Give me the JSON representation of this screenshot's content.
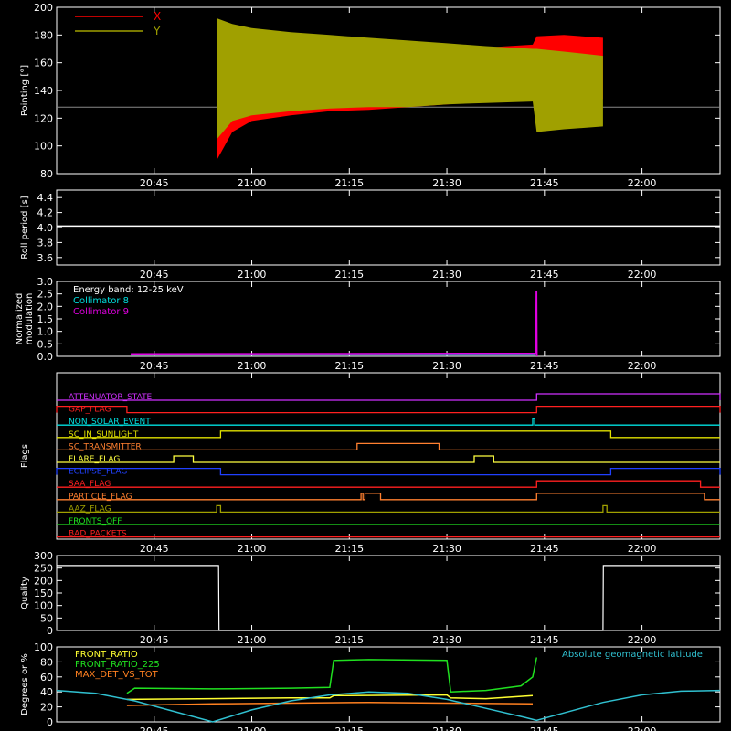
{
  "chart_data": [
    {
      "id": "pointing",
      "type": "line",
      "ylabel": "Pointing [°]",
      "ylim": [
        80,
        200
      ],
      "yticks": [
        "80",
        "100",
        "120",
        "140",
        "160",
        "180",
        "200"
      ],
      "xlim": [
        20.5,
        22.2
      ],
      "xticks": [
        "20:45",
        "21:00",
        "21:15",
        "21:30",
        "21:45",
        "22:00"
      ],
      "reference_line": 128,
      "series": [
        {
          "name": "X",
          "color": "#ff0000",
          "envelope": {
            "t": [
              20.911,
              20.95,
              21.0,
              21.1,
              21.2,
              21.3,
              21.4,
              21.5,
              21.6,
              21.72,
              21.73,
              21.8,
              21.9
            ],
            "lo": [
              90,
              110,
              118,
              122,
              125,
              126,
              128,
              130,
              132,
              134,
              130,
              132,
              134
            ],
            "hi": [
              175,
              168,
              165,
              166,
              168,
              170,
              170,
              168,
              171,
              173,
              179,
              180,
              178
            ]
          }
        },
        {
          "name": "Y",
          "color": "#a0a000",
          "envelope": {
            "t": [
              20.911,
              20.95,
              21.0,
              21.1,
              21.2,
              21.3,
              21.4,
              21.5,
              21.6,
              21.72,
              21.73,
              21.8,
              21.9
            ],
            "lo": [
              105,
              118,
              122,
              125,
              127,
              128,
              128,
              130,
              131,
              132,
              110,
              112,
              114
            ],
            "hi": [
              192,
              188,
              185,
              182,
              180,
              178,
              176,
              174,
              172,
              170,
              170,
              168,
              165
            ]
          }
        }
      ]
    },
    {
      "id": "roll",
      "type": "line",
      "ylabel": "Roll period [s]",
      "ylim": [
        3.5,
        4.5
      ],
      "yticks": [
        "3.6",
        "3.8",
        "4.0",
        "4.2",
        "4.4"
      ],
      "xlim": [
        20.5,
        22.2
      ],
      "xticks": [
        "20:45",
        "21:00",
        "21:15",
        "21:30",
        "21:45",
        "22:00"
      ],
      "series": [
        {
          "name": "",
          "color": "#ffffff",
          "x": [
            20.5,
            22.2
          ],
          "y": [
            4.02,
            4.02
          ]
        }
      ]
    },
    {
      "id": "modulation",
      "type": "line",
      "ylabel": "Normalized modulation",
      "ylim": [
        0,
        3.0
      ],
      "yticks": [
        "0.0",
        "0.5",
        "1.0",
        "1.5",
        "2.0",
        "2.5",
        "3.0"
      ],
      "xlim": [
        20.5,
        22.2
      ],
      "xticks": [
        "20:45",
        "21:00",
        "21:15",
        "21:30",
        "21:45",
        "22:00"
      ],
      "legend": [
        "Energy band: 12-25 keV",
        "Collimator 8",
        "Collimator 9"
      ],
      "series": [
        {
          "name": "Collimator 8",
          "color": "#00e0e0",
          "x": [
            20.69,
            21.728
          ],
          "y": [
            0.06,
            0.06
          ]
        },
        {
          "name": "Collimator 9",
          "color": "#e000e0",
          "x": [
            20.69,
            21.728,
            21.729,
            21.73,
            21.731
          ],
          "y": [
            0.1,
            0.12,
            2.6,
            2.6,
            0.0
          ]
        }
      ]
    },
    {
      "id": "flags",
      "type": "line",
      "ylabel": "Flags",
      "xlim": [
        20.5,
        22.2
      ],
      "xticks": [
        "20:45",
        "21:00",
        "21:15",
        "21:30",
        "21:45",
        "22:00"
      ],
      "flags": [
        {
          "name": "ATTENUATOR_STATE",
          "color": "#d030ff",
          "on": [
            [
              21.73,
              22.2
            ]
          ]
        },
        {
          "name": "GAP_FLAG",
          "color": "#ff2020",
          "on": [
            [
              20.5,
              20.68
            ],
            [
              21.73,
              22.2
            ]
          ]
        },
        {
          "name": "NON_SOLAR_EVENT",
          "color": "#00e0e0",
          "on": [
            [
              21.72,
              21.725
            ]
          ]
        },
        {
          "name": "SC_IN_SUNLIGHT",
          "color": "#e0e000",
          "on": [
            [
              20.92,
              21.92
            ]
          ]
        },
        {
          "name": "SC_TRANSMITTER",
          "color": "#ff8030",
          "on": [
            [
              21.27,
              21.48
            ]
          ]
        },
        {
          "name": "FLARE_FLAG",
          "color": "#ffff40",
          "on": [
            [
              20.8,
              20.85
            ],
            [
              21.57,
              21.62
            ]
          ]
        },
        {
          "name": "ECLIPSE_FLAG",
          "color": "#2040ff",
          "on": [
            [
              20.5,
              20.92
            ],
            [
              21.92,
              22.2
            ]
          ]
        },
        {
          "name": "SAA_FLAG",
          "color": "#ff2020",
          "on": [
            [
              21.73,
              22.15
            ]
          ]
        },
        {
          "name": "PARTICLE_FLAG",
          "color": "#ff8030",
          "on": [
            [
              21.28,
              21.285
            ],
            [
              21.29,
              21.33
            ],
            [
              21.73,
              22.16
            ]
          ]
        },
        {
          "name": "AAZ_FLAG",
          "color": "#a0a000",
          "on": [
            [
              20.91,
              20.92
            ],
            [
              21.9,
              21.91
            ]
          ]
        },
        {
          "name": "FRONTS_OFF",
          "color": "#20e020",
          "on": []
        },
        {
          "name": "BAD_PACKETS",
          "color": "#ff2020",
          "on": []
        }
      ]
    },
    {
      "id": "quality",
      "type": "line",
      "ylabel": "Quality",
      "ylim": [
        0,
        300
      ],
      "yticks": [
        "0",
        "50",
        "100",
        "150",
        "200",
        "250",
        "300"
      ],
      "xlim": [
        20.5,
        22.2
      ],
      "xticks": [
        "20:45",
        "21:00",
        "21:15",
        "21:30",
        "21:45",
        "22:00"
      ],
      "series": [
        {
          "name": "",
          "color": "#ffffff",
          "x": [
            20.5,
            20.915,
            20.916,
            21.9,
            21.901,
            22.2
          ],
          "y": [
            260,
            260,
            0,
            0,
            260,
            260
          ]
        }
      ]
    },
    {
      "id": "ratios",
      "type": "line",
      "ylabel": "Degrees or %",
      "ylim": [
        0,
        100
      ],
      "yticks": [
        "0",
        "20",
        "40",
        "60",
        "80",
        "100"
      ],
      "xlim": [
        20.5,
        22.2
      ],
      "xticks": [
        "20:45",
        "21:00",
        "21:15",
        "21:30",
        "21:45",
        "22:00"
      ],
      "legend_left": [
        "FRONT_RATIO",
        "FRONT_RATIO_225",
        "MAX_DET_VS_TOT"
      ],
      "legend_right": "Absolute geomagnetic latitude",
      "series": [
        {
          "name": "FRONT_RATIO_225",
          "color": "#20e020",
          "x": [
            20.68,
            20.7,
            20.9,
            21.1,
            21.2,
            21.21,
            21.3,
            21.5,
            21.51,
            21.6,
            21.69,
            21.72,
            21.73
          ],
          "y": [
            38,
            45,
            44,
            45,
            46,
            82,
            83,
            82,
            40,
            42,
            48,
            60,
            86
          ]
        },
        {
          "name": "FRONT_RATIO",
          "color": "#ffff30",
          "x": [
            20.68,
            20.9,
            21.1,
            21.2,
            21.21,
            21.5,
            21.51,
            21.6,
            21.72
          ],
          "y": [
            30,
            31,
            32,
            32,
            35,
            36,
            32,
            31,
            35
          ]
        },
        {
          "name": "MAX_DET_VS_TOT",
          "color": "#ff8020",
          "x": [
            20.68,
            20.9,
            21.1,
            21.3,
            21.5,
            21.72
          ],
          "y": [
            22,
            24,
            25,
            26,
            25,
            24
          ]
        },
        {
          "name": "Absolute geomagnetic latitude",
          "color": "#30c0d0",
          "x": [
            20.5,
            20.6,
            20.7,
            20.8,
            20.9,
            21.0,
            21.1,
            21.2,
            21.3,
            21.4,
            21.5,
            21.6,
            21.7,
            21.73,
            21.8,
            21.9,
            22.0,
            22.1,
            22.2
          ],
          "y": [
            42,
            38,
            28,
            14,
            0,
            16,
            28,
            36,
            40,
            38,
            30,
            18,
            6,
            2,
            12,
            26,
            36,
            41,
            42
          ]
        }
      ]
    }
  ]
}
